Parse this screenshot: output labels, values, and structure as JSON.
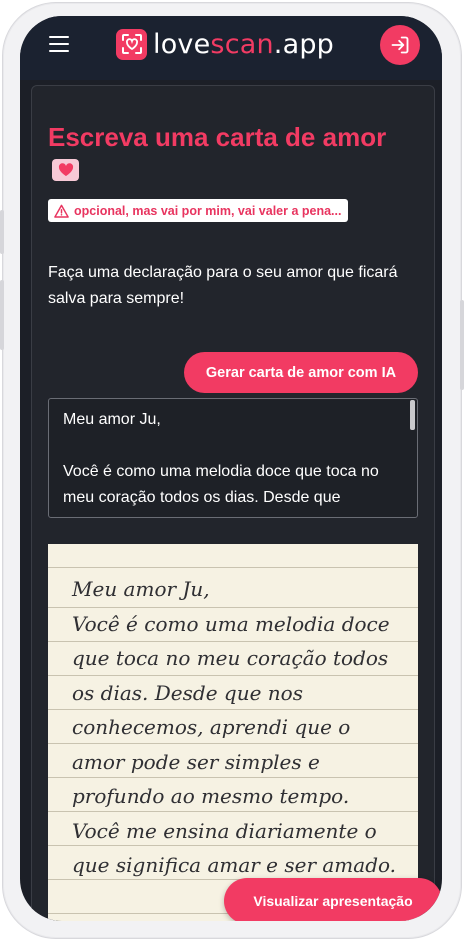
{
  "header": {
    "logo_text_white_1": "love",
    "logo_text_accent": "scan",
    "logo_text_white_2": ".app",
    "menu_icon": "hamburger-icon",
    "login_icon": "login-arrow-icon"
  },
  "main": {
    "title": "Escreva uma carta de amor",
    "badge": "opcional, mas vai por mim, vai valer a pena...",
    "description": "Faça uma declaração para o seu amor que ficará salva para sempre!",
    "generate_button": "Gerar carta de amor com IA",
    "letter_text": "Meu amor Ju,\n\nVocê é como uma melodia doce que toca no meu coração todos os dias. Desde que"
  },
  "preview": {
    "letter_text": "Meu amor Ju,\nVocê é como uma melodia doce que toca no meu coração todos os dias. Desde que nos conhecemos, aprendi que o amor pode ser simples e profundo ao mesmo tempo. Você me ensina diariamente o que significa amar e ser amado."
  },
  "present_button": "Visualizar apresentação",
  "colors": {
    "accent": "#f23b63",
    "background": "#1c1f27",
    "paper": "#f6f2e3"
  }
}
